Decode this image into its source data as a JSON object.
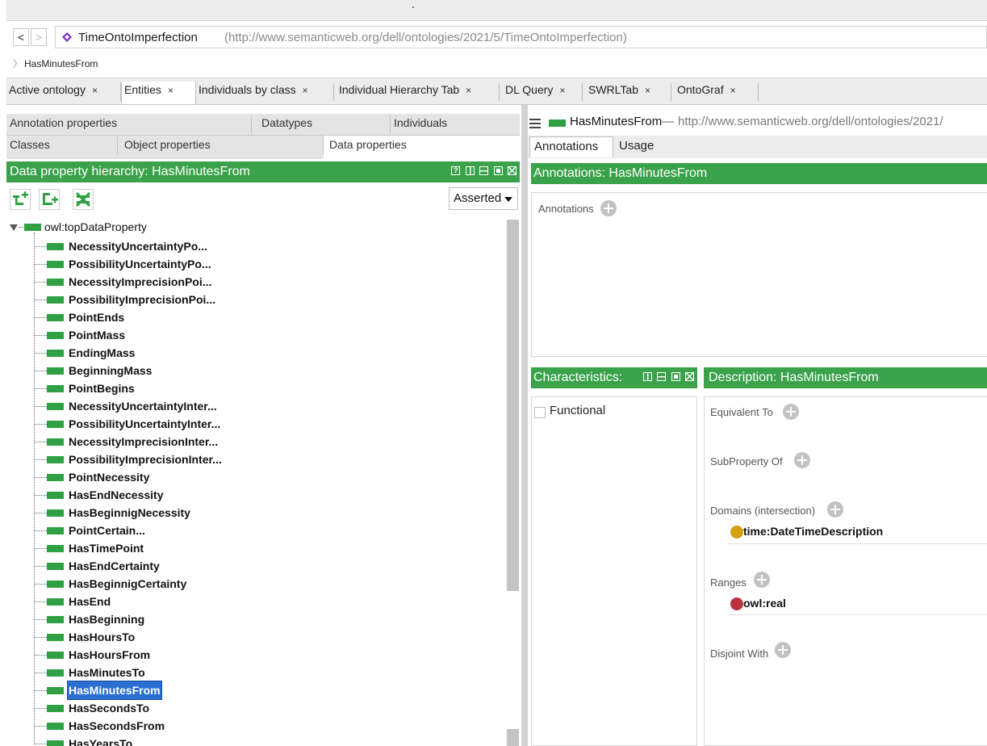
{
  "colors": {
    "accent_green": "#3aa24a",
    "entity_green": "#2fa043",
    "selection_blue": "#2a6fd1",
    "domain_dot": "#d4a20a",
    "range_dot": "#b8343f",
    "ontology_icon": "#7b2fbe"
  },
  "nav": {
    "back_label": "<",
    "forward_label": ">",
    "ontology_name": "TimeOntoImperfection",
    "ontology_iri": "(http://www.semanticweb.org/dell/ontologies/2021/5/TimeOntoImperfection)",
    "breadcrumb": "HasMinutesFrom"
  },
  "tabs": [
    {
      "label": "Active ontology",
      "close": "×"
    },
    {
      "label": "Entities",
      "close": "×"
    },
    {
      "label": "Individuals by class",
      "close": "×"
    },
    {
      "label": "Individual Hierarchy Tab",
      "close": "×"
    },
    {
      "label": "DL Query",
      "close": "×"
    },
    {
      "label": "SWRLTab",
      "close": "×"
    },
    {
      "label": "OntoGraf",
      "close": "×"
    }
  ],
  "entity_tabs": {
    "row1": [
      "Annotation properties",
      "Datatypes",
      "Individuals"
    ],
    "row2": [
      "Classes",
      "Object properties",
      "Data properties"
    ]
  },
  "hierarchy": {
    "header": "Data property hierarchy: HasMinutesFrom",
    "help_glyph": "?",
    "asserted": "Asserted",
    "root": "owl:topDataProperty",
    "items": [
      "NecessityUncertaintyPo...",
      "PossibilityUncertaintyPo...",
      "NecessityImprecisionPoi...",
      "PossibilityImprecisionPoi...",
      "PointEnds",
      "PointMass",
      "EndingMass",
      "BeginningMass",
      "PointBegins",
      "NecessityUncertaintyInter...",
      "PossibilityUncertaintyInter...",
      "NecessityImprecisionInter...",
      "PossibilityImprecisionInter...",
      "PointNecessity",
      "HasEndNecessity",
      "HasBeginnigNecessity",
      "PointCertain...",
      "HasTimePoint",
      "HasEndCertainty",
      "HasBeginnigCertainty",
      "HasEnd",
      "HasBeginning",
      "HasHoursTo",
      "HasHoursFrom",
      "HasMinutesTo",
      "HasMinutesFrom",
      "HasSecondsTo",
      "HasSecondsFrom",
      "HasYearsTo"
    ],
    "selected": "HasMinutesFrom"
  },
  "entity": {
    "menu_icon": "menu-icon",
    "name": "HasMinutesFrom",
    "dash": "—",
    "iri": "http://www.semanticweb.org/dell/ontologies/2021/"
  },
  "annotation_tabs": [
    "Annotations",
    "Usage"
  ],
  "annotations": {
    "header": "Annotations: HasMinutesFrom",
    "label": "Annotations"
  },
  "characteristics": {
    "header": "Characteristics:",
    "functional": "Functional"
  },
  "description": {
    "header": "Description: HasMinutesFrom",
    "equivalent_to": "Equivalent To",
    "subproperty_of": "SubProperty Of",
    "domains": "Domains (intersection)",
    "domain_value": "time:DateTimeDescription",
    "ranges": "Ranges",
    "range_value": "owl:real",
    "disjoint_with": "Disjoint With"
  }
}
